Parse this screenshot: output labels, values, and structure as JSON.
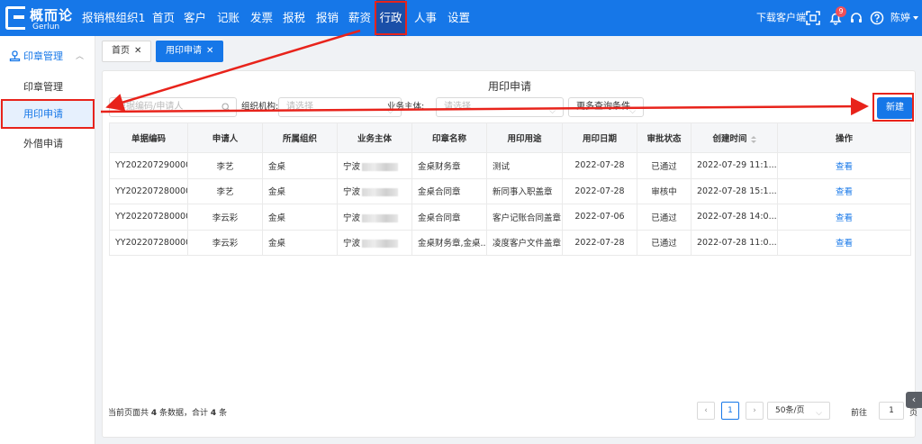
{
  "app": {
    "logo_cn": "概而论",
    "logo_en": "Gerlun",
    "brand_color": "#1677e8",
    "active_nav_color": "#1a4fa8"
  },
  "nav": [
    {
      "label": "报销根组织1"
    },
    {
      "label": "首页"
    },
    {
      "label": "客户"
    },
    {
      "label": "记账"
    },
    {
      "label": "发票"
    },
    {
      "label": "报税"
    },
    {
      "label": "报销"
    },
    {
      "label": "薪资"
    },
    {
      "label": "行政",
      "active": true
    },
    {
      "label": "人事"
    },
    {
      "label": "设置"
    }
  ],
  "topright": {
    "download_label": "下载客户端",
    "notification_count": "9",
    "username": "陈婷",
    "icons": [
      "scan-icon",
      "bell-icon",
      "headset-icon",
      "help-icon"
    ]
  },
  "sidebar": {
    "group_label": "印章管理",
    "items": [
      {
        "label": "印章管理"
      },
      {
        "label": "用印申请",
        "active": true
      },
      {
        "label": "外借申请"
      }
    ]
  },
  "tabs": [
    {
      "label": "首页"
    },
    {
      "label": "用印申请",
      "active": true
    }
  ],
  "page": {
    "title": "用印申请",
    "search_placeholder": "单据编码/申请人",
    "org_label": "组织机构:",
    "org_placeholder": "请选择",
    "entity_label": "业务主体:",
    "entity_placeholder": "请选择",
    "more_filters": "更多查询条件",
    "new_button": "新建"
  },
  "table": {
    "columns": [
      "单据编码",
      "申请人",
      "所属组织",
      "业务主体",
      "印章名称",
      "用印用途",
      "用印日期",
      "审批状态",
      "创建时间",
      "操作"
    ],
    "rows": [
      {
        "code": "YY202207290000...",
        "applicant": "李艺",
        "org": "金桌",
        "entity": "宁波",
        "seal": "金桌财务章",
        "purpose": "测试",
        "date": "2022-07-28",
        "status": "已通过",
        "created": "2022-07-29 11:1...",
        "action": "查看"
      },
      {
        "code": "YY202207280000...",
        "applicant": "李艺",
        "org": "金桌",
        "entity": "宁波",
        "seal": "金桌合同章",
        "purpose": "新同事入职盖章",
        "date": "2022-07-28",
        "status": "审核中",
        "created": "2022-07-28 15:1...",
        "action": "查看"
      },
      {
        "code": "YY202207280000...",
        "applicant": "李云彩",
        "org": "金桌",
        "entity": "宁波",
        "seal": "金桌合同章",
        "purpose": "客户记账合同盖章",
        "date": "2022-07-06",
        "status": "已通过",
        "created": "2022-07-28 14:0...",
        "action": "查看"
      },
      {
        "code": "YY202207280000...",
        "applicant": "李云彩",
        "org": "金桌",
        "entity": "宁波",
        "seal": "金桌财务章,金桌...",
        "purpose": "凌度客户文件盖章",
        "date": "2022-07-28",
        "status": "已通过",
        "created": "2022-07-28 11:0...",
        "action": "查看"
      }
    ]
  },
  "footer": {
    "summary_prefix": "当前页面共",
    "summary_count": "4",
    "summary_middle": "条数据，合计",
    "summary_total": "4",
    "summary_suffix": "条",
    "current_page": "1",
    "page_size": "50条/页",
    "goto_label": "前往",
    "goto_value": "1",
    "page_unit": "页"
  },
  "annotation_color": "#e8231b"
}
